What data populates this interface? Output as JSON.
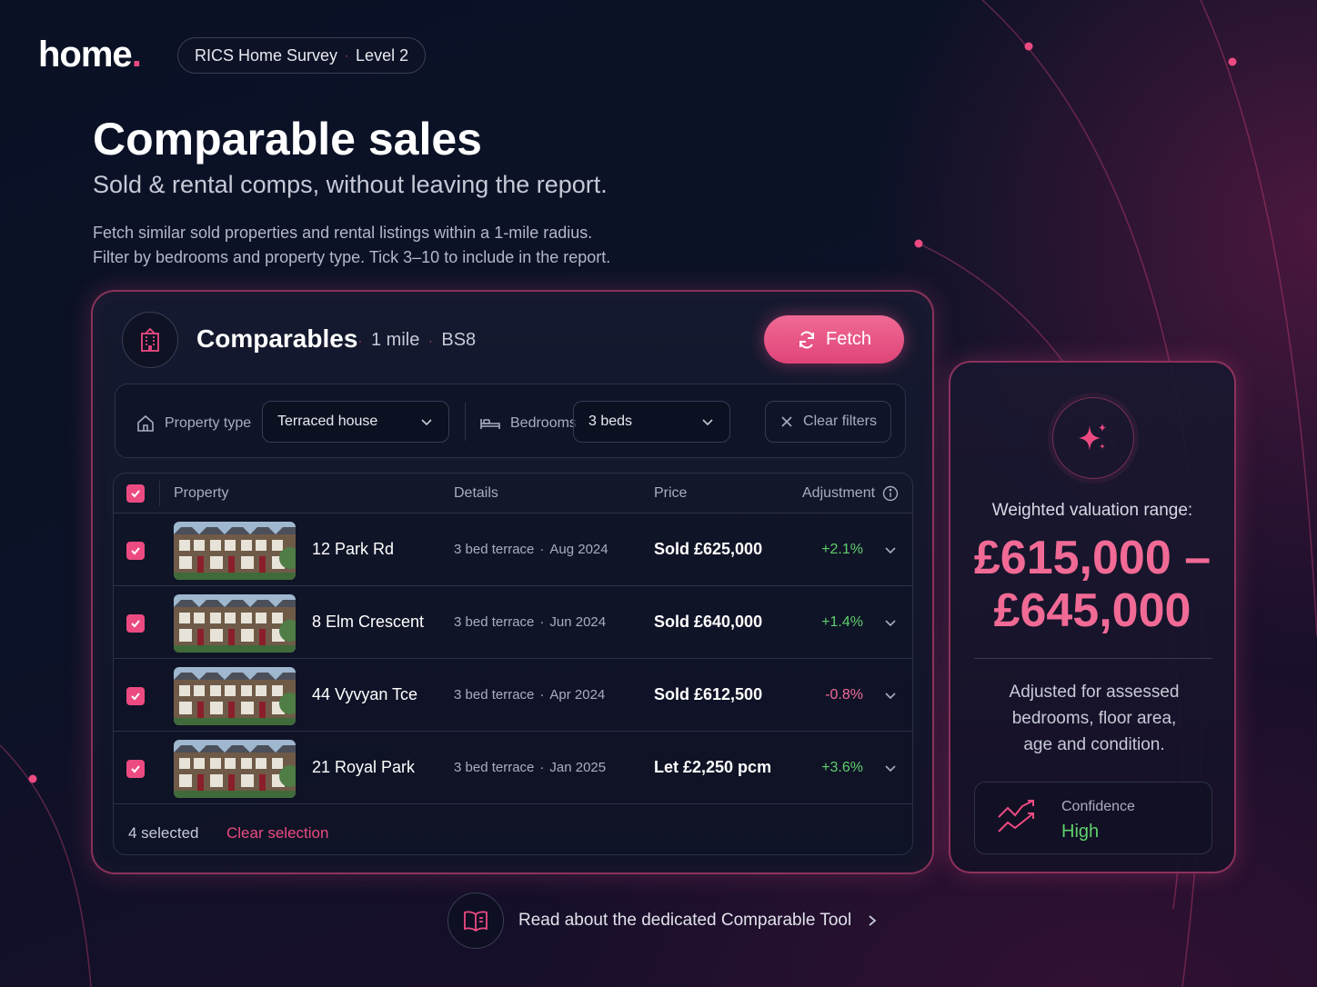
{
  "brand": {
    "logo_text": "home",
    "logo_dot": ".",
    "accent": "#ec4b82"
  },
  "survey_pill": {
    "left": "RICS Home Survey",
    "separator": "·",
    "right": "Level 2"
  },
  "hero": {
    "title": "Comparable sales",
    "subtitle": "Sold & rental comps, without leaving the report.",
    "description_line1": "Fetch similar sold properties and rental listings within a 1-mile radius.",
    "description_line2": "Filter by bedrooms and property type. Tick 3–10 to include in the report."
  },
  "comparables": {
    "icon": "building-icon",
    "title": "Comparables",
    "radius": "1 mile",
    "postcode": "BS8",
    "separator": "·",
    "fetch_label": "Fetch",
    "filters": {
      "property_type_label": "Property type",
      "property_type_value": "Terraced house",
      "bedrooms_label": "Bedrooms",
      "bedrooms_value": "3 beds",
      "clear_label": "Clear filters"
    },
    "columns": {
      "property": "Property",
      "details": "Details",
      "price": "Price",
      "adjustment": "Adjustment"
    },
    "rows": [
      {
        "checked": true,
        "name": "12 Park Rd",
        "type": "3 bed terrace",
        "date": "Aug 2024",
        "price": "Sold £625,000",
        "adjustment": "+2.1%",
        "adj_color": "#5fcf6d"
      },
      {
        "checked": true,
        "name": "8 Elm Crescent",
        "type": "3 bed terrace",
        "date": "Jun 2024",
        "price": "Sold £640,000",
        "adjustment": "+1.4%",
        "adj_color": "#5fcf6d"
      },
      {
        "checked": true,
        "name": "44 Vyvyan Tce",
        "type": "3 bed terrace",
        "date": "Apr 2024",
        "price": "Sold £612,500",
        "adjustment": "-0.8%",
        "adj_color": "#f06a95"
      },
      {
        "checked": true,
        "name": "21 Royal Park",
        "type": "3 bed terrace",
        "date": "Jan 2025",
        "price": "Let £2,250 pcm",
        "adjustment": "+3.6%",
        "adj_color": "#5fcf6d"
      }
    ],
    "selected_text": "4 selected",
    "clear_selection_label": "Clear selection"
  },
  "valuation": {
    "label": "Weighted valuation range:",
    "range_line1": "£615,000 –",
    "range_line2": "£645,000",
    "note_line1": "Adjusted for assessed",
    "note_line2": "bedrooms, floor area,",
    "note_line3": "age and condition.",
    "confidence_label": "Confidence",
    "confidence_value": "High"
  },
  "read_link": {
    "text": "Read about the dedicated Comparable Tool",
    "icon": "open-book-icon"
  }
}
